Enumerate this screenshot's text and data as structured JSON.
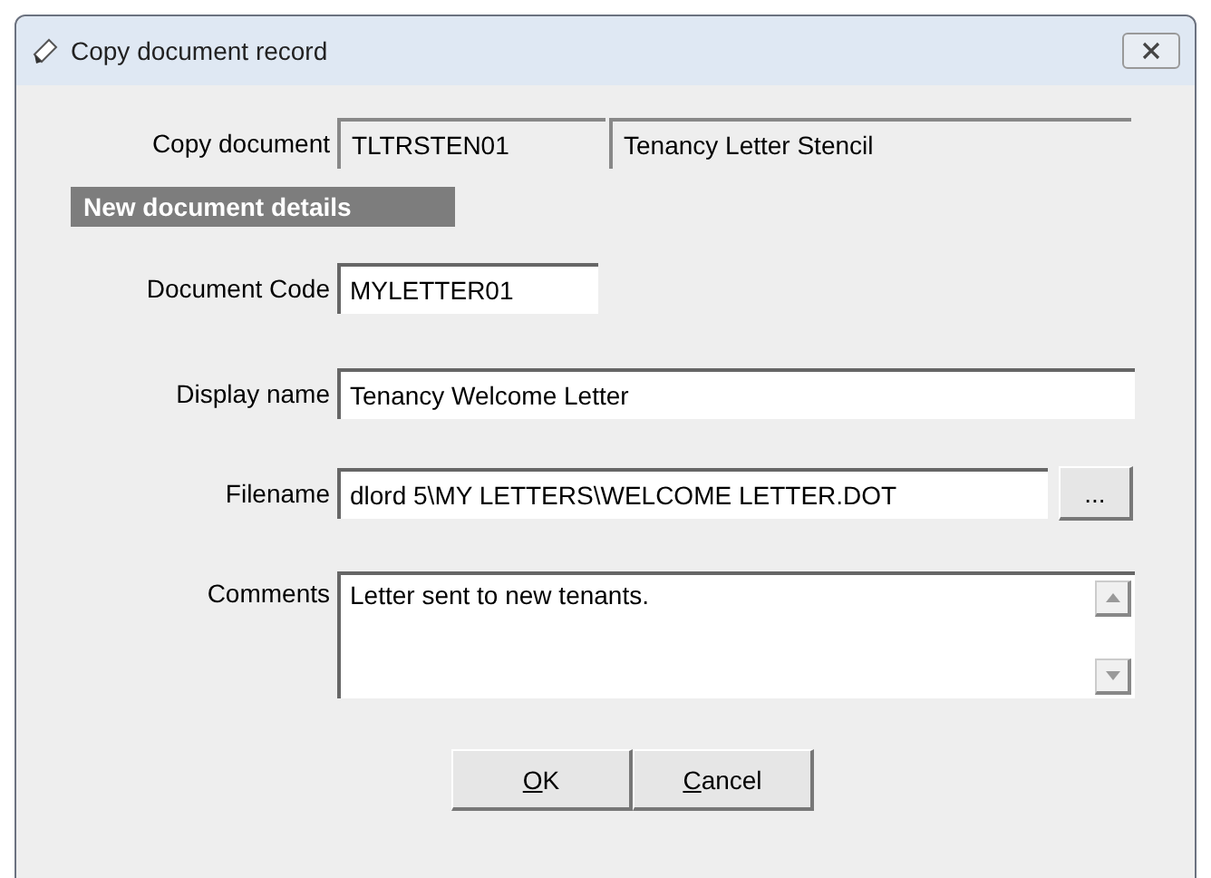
{
  "window": {
    "title": "Copy document record"
  },
  "copy_document": {
    "label": "Copy document",
    "code": "TLTRSTEN01",
    "name": "Tenancy Letter Stencil"
  },
  "section": {
    "title": "New document details"
  },
  "fields": [
    {
      "kind": "short",
      "label": "Document Code",
      "value": "MYLETTER01"
    },
    {
      "kind": "wide",
      "label": "Display name",
      "value": "Tenancy Welcome Letter"
    },
    {
      "kind": "browse",
      "label": "Filename",
      "value": "dlord 5\\MY LETTERS\\WELCOME LETTER.DOT",
      "button": "..."
    },
    {
      "kind": "memo",
      "label": "Comments",
      "value": "Letter sent to new tenants."
    }
  ],
  "buttons": [
    {
      "access_key": "O",
      "label_rest": "K"
    },
    {
      "access_key": "C",
      "label_rest": "ancel"
    }
  ]
}
